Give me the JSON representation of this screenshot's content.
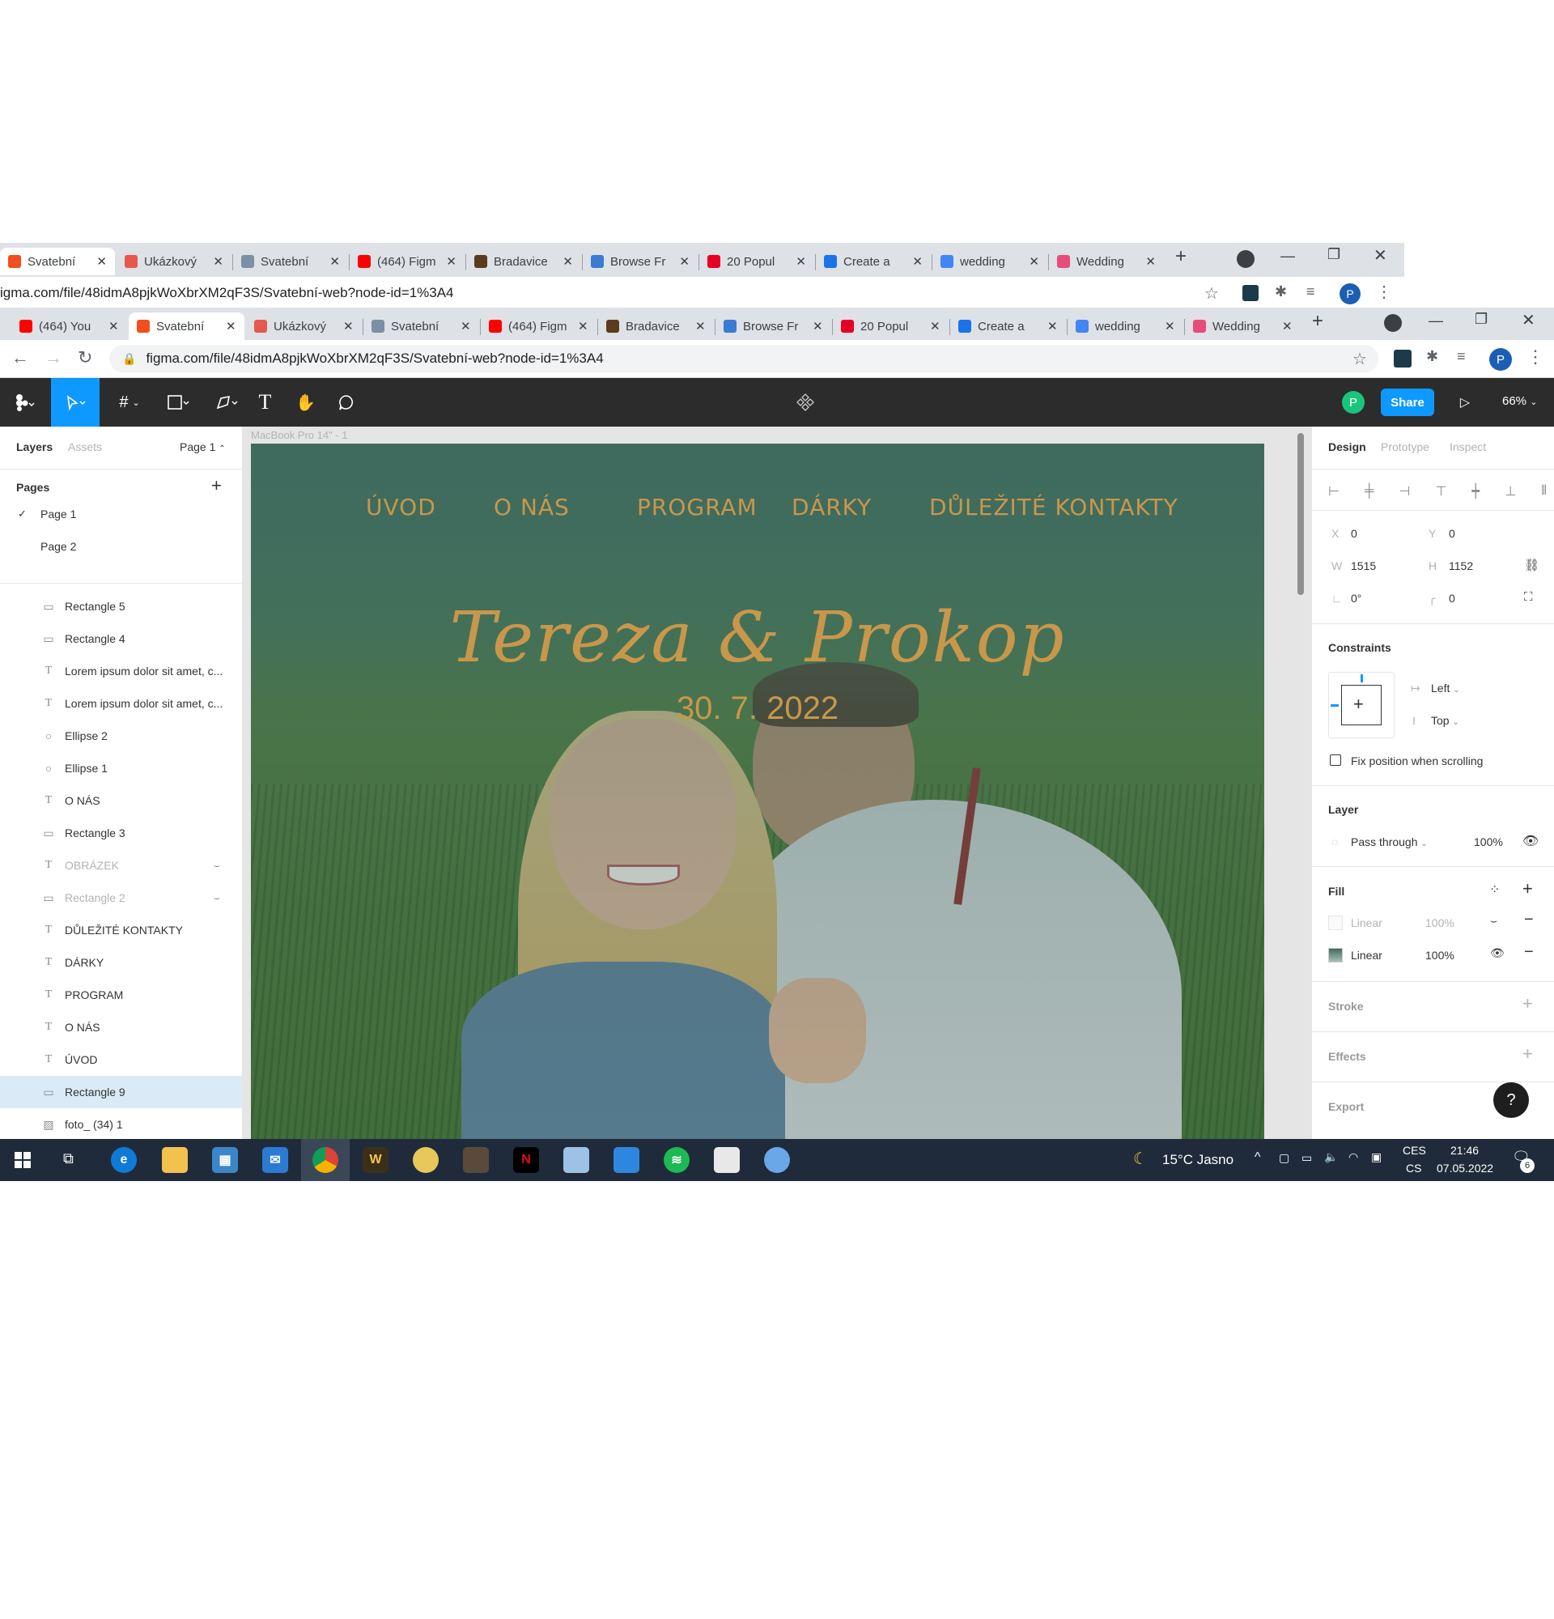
{
  "back_browser": {
    "tabs": [
      {
        "label": "Svatební",
        "color": "#f24e1e"
      },
      {
        "label": "Ukázkový",
        "color": "#e6584e"
      },
      {
        "label": "Svatební",
        "color": "#7b8fa6"
      },
      {
        "label": "(464) Figm",
        "color": "#ff0000"
      },
      {
        "label": "Bradavice",
        "color": "#5a3b1d"
      },
      {
        "label": "Browse Fr",
        "color": "#3a7bd5"
      },
      {
        "label": "20 Popul",
        "color": "#e60023"
      },
      {
        "label": "Create a",
        "color": "#1a73e8"
      },
      {
        "label": "wedding",
        "color": "#4285f4"
      },
      {
        "label": "Wedding",
        "color": "#e84d7a"
      }
    ],
    "url": "igma.com/file/48idmA8pjkWoXbrXM2qF3S/Svatební-web?node-id=1%3A4",
    "profile_initial": "P"
  },
  "front_browser": {
    "tabs": [
      {
        "label": "(464) You",
        "color": "#ff0000"
      },
      {
        "label": "Svatební",
        "color": "#f24e1e"
      },
      {
        "label": "Ukázkový",
        "color": "#e6584e"
      },
      {
        "label": "Svatební",
        "color": "#7b8fa6"
      },
      {
        "label": "(464) Figm",
        "color": "#ff0000"
      },
      {
        "label": "Bradavice",
        "color": "#5a3b1d"
      },
      {
        "label": "Browse Fr",
        "color": "#3a7bd5"
      },
      {
        "label": "20 Popul",
        "color": "#e60023"
      },
      {
        "label": "Create a",
        "color": "#1a73e8"
      },
      {
        "label": "wedding",
        "color": "#4285f4"
      },
      {
        "label": "Wedding",
        "color": "#e84d7a"
      }
    ],
    "url": "figma.com/file/48idmA8pjkWoXbrXM2qF3S/Svatební-web?node-id=1%3A4",
    "profile_initial": "P"
  },
  "toolbar": {
    "avatar_initial": "P",
    "share_label": "Share",
    "zoom": "66%",
    "accent": "#0d99ff"
  },
  "left_panel": {
    "tab_layers": "Layers",
    "tab_assets": "Assets",
    "page_selector": "Page 1",
    "pages_title": "Pages",
    "pages": [
      "Page 1",
      "Page 2"
    ],
    "layers": [
      {
        "name": "Rectangle 5",
        "icon": "rect"
      },
      {
        "name": "Rectangle 4",
        "icon": "rect"
      },
      {
        "name": "Lorem ipsum dolor sit amet, c...",
        "icon": "text"
      },
      {
        "name": "Lorem ipsum dolor sit amet, c...",
        "icon": "text"
      },
      {
        "name": "Ellipse 2",
        "icon": "ellipse"
      },
      {
        "name": "Ellipse 1",
        "icon": "ellipse"
      },
      {
        "name": "O NÁS",
        "icon": "text"
      },
      {
        "name": "Rectangle 3",
        "icon": "rect"
      },
      {
        "name": "OBRÁZEK",
        "icon": "text",
        "hidden": true
      },
      {
        "name": "Rectangle 2",
        "icon": "rect",
        "hidden": true
      },
      {
        "name": "DŮLEŽITÉ KONTAKTY",
        "icon": "text"
      },
      {
        "name": "DÁRKY",
        "icon": "text"
      },
      {
        "name": "PROGRAM",
        "icon": "text"
      },
      {
        "name": "O NÁS",
        "icon": "text"
      },
      {
        "name": "ÚVOD",
        "icon": "text"
      },
      {
        "name": "Rectangle 9",
        "icon": "rect",
        "selected": true
      },
      {
        "name": "foto_ (34) 1",
        "icon": "image"
      }
    ]
  },
  "canvas": {
    "frame_label": "MacBook Pro 14\" - 1",
    "nav": [
      "ÚVOD",
      "O NÁS",
      "PROGRAM",
      "DÁRKY",
      "DŮLEŽITÉ KONTAKTY"
    ],
    "names": "Tereza & Prokop",
    "date": "30. 7. 2022",
    "accent_gold": "#c9974a",
    "overlay_green": "#3f6b5e"
  },
  "right_panel": {
    "tabs": [
      "Design",
      "Prototype",
      "Inspect"
    ],
    "x_label": "X",
    "x": "0",
    "y_label": "Y",
    "y": "0",
    "w_label": "W",
    "w": "1515",
    "h_label": "H",
    "h": "1152",
    "rotation": "0°",
    "radius": "0",
    "constraints_title": "Constraints",
    "constraint_h": "Left",
    "constraint_v": "Top",
    "fix_position": "Fix position when scrolling",
    "layer_title": "Layer",
    "blend": "Pass through",
    "layer_opacity": "100%",
    "fill_title": "Fill",
    "fills": [
      {
        "type": "Linear",
        "opacity": "100%",
        "hidden": true
      },
      {
        "type": "Linear",
        "opacity": "100%",
        "hidden": false
      }
    ],
    "stroke_title": "Stroke",
    "effects_title": "Effects",
    "export_title": "Export",
    "help": "?"
  },
  "taskbar": {
    "weather": "15°C  Jasno",
    "lang_top": "CES",
    "lang_bottom": "CS",
    "time": "21:46",
    "date": "07.05.2022",
    "notifications": "6"
  }
}
